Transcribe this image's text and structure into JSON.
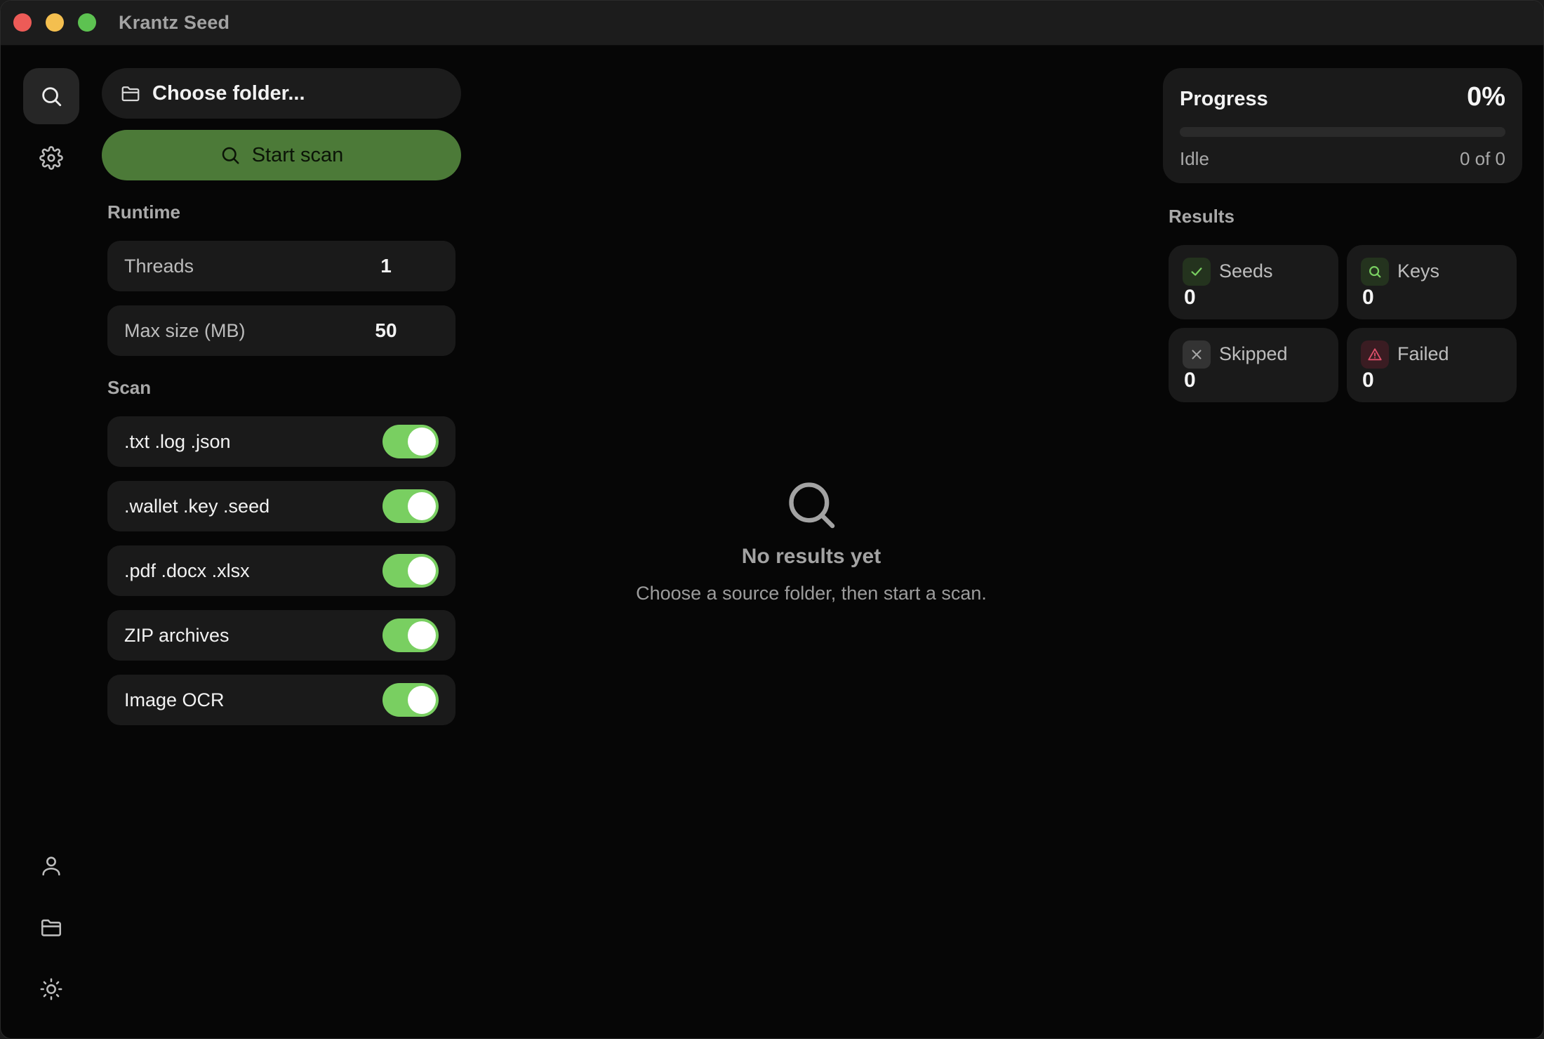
{
  "window": {
    "title": "Krantz Seed"
  },
  "sidebar": {
    "top": [
      {
        "name": "search-icon",
        "active": true
      },
      {
        "name": "gear-icon",
        "active": false
      }
    ],
    "bottom": [
      {
        "name": "user-icon"
      },
      {
        "name": "folder-icon"
      },
      {
        "name": "sun-icon"
      }
    ]
  },
  "controls": {
    "choose_folder_label": "Choose folder...",
    "start_scan_label": "Start scan",
    "accent_color": "#4c7a38"
  },
  "runtime": {
    "label": "Runtime",
    "threads": {
      "label": "Threads",
      "value": "1"
    },
    "max_size": {
      "label": "Max size (MB)",
      "value": "50"
    }
  },
  "scan": {
    "label": "Scan",
    "toggles": [
      {
        "label": ".txt .log .json",
        "on": true
      },
      {
        "label": ".wallet .key .seed",
        "on": true
      },
      {
        "label": ".pdf .docx .xlsx",
        "on": true
      },
      {
        "label": "ZIP archives",
        "on": true
      },
      {
        "label": "Image OCR",
        "on": true
      }
    ],
    "toggle_on_color": "#79cf61"
  },
  "empty_state": {
    "icon": "search-icon",
    "title": "No results yet",
    "subtitle": "Choose a source folder, then start a scan."
  },
  "progress": {
    "title": "Progress",
    "percent_label": "0%",
    "percent": 0,
    "status": "Idle",
    "count": "0 of 0"
  },
  "results": {
    "label": "Results",
    "stats": [
      {
        "label": "Seeds",
        "value": "0",
        "icon": "check-icon",
        "color": "#79cf61"
      },
      {
        "label": "Keys",
        "value": "0",
        "icon": "search-icon",
        "color": "#79cf61"
      },
      {
        "label": "Skipped",
        "value": "0",
        "icon": "x-icon",
        "color": "#9a9a9a"
      },
      {
        "label": "Failed",
        "value": "0",
        "icon": "warning-icon",
        "color": "#e0506b"
      }
    ]
  }
}
